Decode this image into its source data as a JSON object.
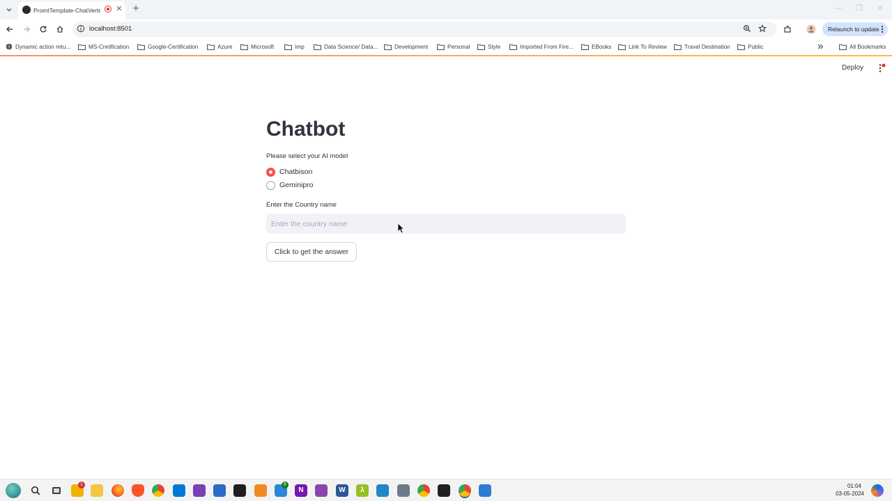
{
  "browser": {
    "tab_title": "PromtTemplate-ChatVerte...",
    "url": "localhost:8501",
    "relaunch_label": "Relaunch to update",
    "bookmarks": [
      "Dynamic action retu...",
      "MS-Cretification",
      "Google-Certification",
      "Azure",
      "Microsoft",
      "Imp",
      "Data Science/ Data...",
      "Development",
      "Personal",
      "Style",
      "Imported From Fire...",
      "EBooks",
      "Link To Review",
      "Travel Destination",
      "Public"
    ],
    "all_bookmarks_label": "All Bookmarks"
  },
  "app": {
    "deploy_label": "Deploy",
    "title": "Chatbot",
    "model_label": "Please select your AI model",
    "model_options": [
      "Chatbison",
      "Geminipro"
    ],
    "selected_model": "Chatbison",
    "country_label": "Enter the Country name",
    "country_placeholder": "Enter the country name",
    "country_value": "",
    "answer_button_label": "Click to get the answer"
  },
  "taskbar": {
    "badges": {
      "files_count": "1",
      "todo_count": "6"
    },
    "time": "01:04",
    "date": "03-05-2024"
  },
  "colors": {
    "accent": "#ff4b4b",
    "input_bg": "#f0f2f6",
    "relaunch_bg": "#d3e3fd",
    "text": "#31333f"
  }
}
